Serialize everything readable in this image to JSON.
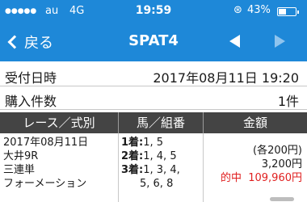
{
  "status_bar": {
    "signal": "●●●●●",
    "carrier": "au",
    "network": "4G",
    "time": "19:59",
    "lock_icon": "rotation-lock-icon",
    "battery_text": "43%",
    "battery_level": 0.43
  },
  "nav": {
    "back_label": "戻る",
    "title": "SPAT4",
    "prev_icon": "triangle-left-icon",
    "next_icon": "triangle-right-icon"
  },
  "info": {
    "received_label": "受付日時",
    "received_value": "2017年08月11日 19:20",
    "count_label": "購入件数",
    "count_value": "1件"
  },
  "table": {
    "headers": [
      "レース／式別",
      "馬／組番",
      "金額"
    ],
    "race": [
      "2017年08月11日",
      "大井9R",
      "三連単",
      "フォーメーション"
    ],
    "horses": [
      {
        "place": "1着:",
        "nums": "1, 5"
      },
      {
        "place": "2着:",
        "nums": "1, 4, 5"
      },
      {
        "place": "3着:",
        "nums": "1, 3, 4,",
        "cont": "5, 6, 8"
      }
    ],
    "amount": {
      "per": "(各200円)",
      "total": "3,200円",
      "win_label": "的中",
      "win_amount": "109,960円"
    }
  },
  "colors": {
    "header_blue": "#1e88d8",
    "table_header": "#444444",
    "win_red": "#e02020"
  }
}
